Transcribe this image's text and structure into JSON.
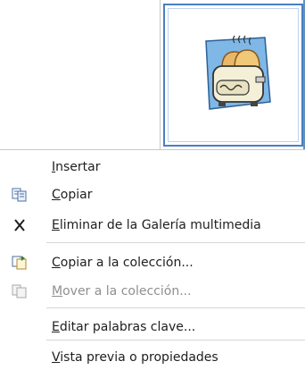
{
  "menu": {
    "items": [
      {
        "label": "Insertar",
        "key": "I",
        "rest": "nsertar",
        "icon": "none",
        "enabled": true
      },
      {
        "label": "Copiar",
        "key": "C",
        "rest": "opiar",
        "icon": "copy-icon",
        "enabled": true
      },
      {
        "label": "Eliminar de la Galería multimedia",
        "key": "E",
        "rest": "liminar de la Galería multimedia",
        "icon": "delete-x-icon",
        "enabled": true
      },
      {
        "label": "Copiar a la colección...",
        "key": "C",
        "rest": "opiar a la colección...",
        "icon": "copy-to-collection-icon",
        "enabled": true
      },
      {
        "label": "Mover a la colección...",
        "key": "M",
        "rest": "over a la colección...",
        "icon": "move-to-collection-icon",
        "enabled": false
      },
      {
        "label": "Editar palabras clave...",
        "key": "E",
        "rest": "ditar palabras clave...",
        "icon": "none",
        "enabled": true
      },
      {
        "label": "Vista previa o propiedades",
        "key": "V",
        "rest": "ista previa o propiedades",
        "icon": "none",
        "enabled": true
      }
    ]
  },
  "gallery": {
    "selected_item": "toaster-clipart"
  },
  "colors": {
    "selection_border": "#4a7fc1",
    "disabled_text": "#8f8f8f"
  }
}
